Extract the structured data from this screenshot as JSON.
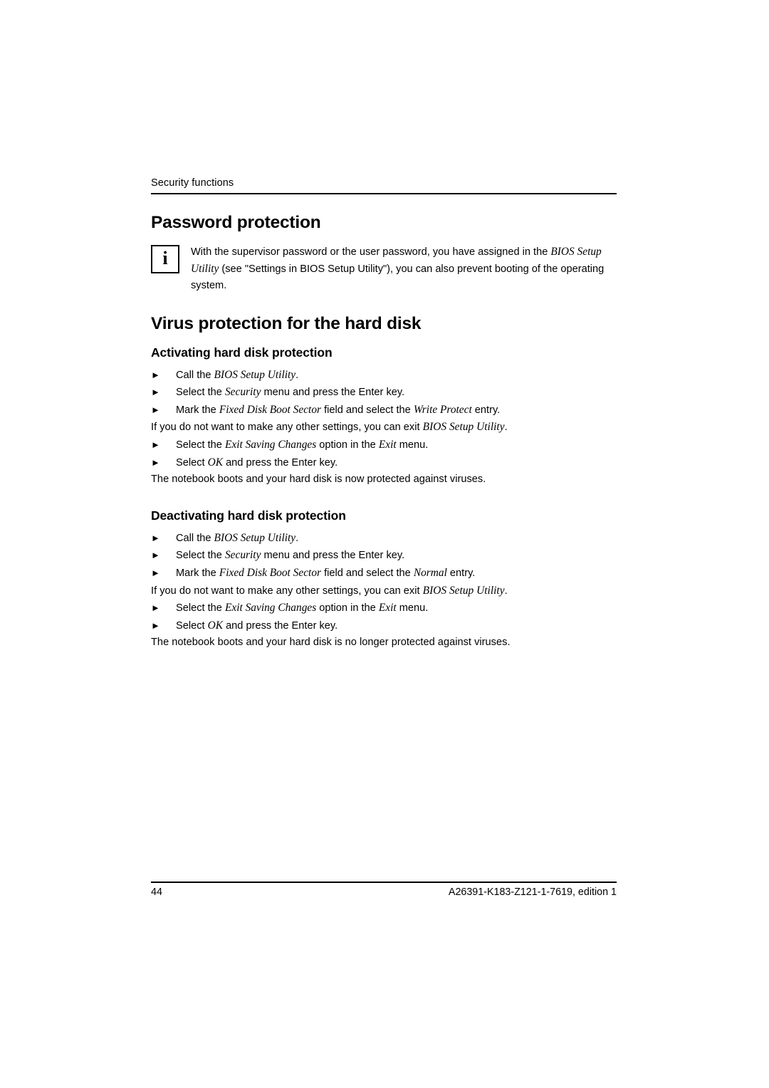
{
  "header": {
    "running_title": "Security functions"
  },
  "sections": {
    "password": {
      "heading": "Password protection",
      "note": {
        "icon": "info-icon",
        "icon_glyph": "i",
        "text_part1": "With the supervisor password or the user password, you have assigned in the ",
        "text_italic1": "BIOS Setup Utility",
        "text_part2": " (see \"Settings in BIOS Setup Utility\"), you can also prevent booting of the operating system."
      }
    },
    "virus": {
      "heading": "Virus protection for the hard disk",
      "activating": {
        "heading": "Activating hard disk protection",
        "steps": [
          {
            "bullet": "►",
            "pre": "Call the ",
            "italic": "BIOS Setup Utility",
            "post": "."
          },
          {
            "bullet": "►",
            "pre": "Select the ",
            "italic": "Security",
            "post": " menu and press the Enter key."
          },
          {
            "bullet": "►",
            "pre": "Mark the ",
            "italic": "Fixed Disk Boot Sector",
            "mid": " field and select the ",
            "italic2": "Write Protect",
            "post": " entry."
          }
        ],
        "note_pre": "If you do not want to make any other settings, you can exit ",
        "note_italic": "BIOS Setup Utility",
        "note_post": ".",
        "steps2": [
          {
            "bullet": "►",
            "pre": "Select the ",
            "italic": "Exit Saving Changes",
            "mid": " option in the ",
            "italic2": "Exit",
            "post": " menu."
          },
          {
            "bullet": "►",
            "pre": "Select ",
            "italic": "OK",
            "post": " and press the Enter key."
          }
        ],
        "result": "The notebook boots and your hard disk is now protected against viruses."
      },
      "deactivating": {
        "heading": "Deactivating hard disk protection",
        "steps": [
          {
            "bullet": "►",
            "pre": "Call the ",
            "italic": "BIOS Setup Utility",
            "post": "."
          },
          {
            "bullet": "►",
            "pre": "Select the ",
            "italic": "Security",
            "post": " menu and press the Enter key."
          },
          {
            "bullet": "►",
            "pre": "Mark the ",
            "italic": "Fixed Disk Boot Sector",
            "mid": " field and select the ",
            "italic2": "Normal",
            "post": " entry."
          }
        ],
        "note_pre": "If you do not want to make any other settings, you can exit ",
        "note_italic": "BIOS Setup Utility",
        "note_post": ".",
        "steps2": [
          {
            "bullet": "►",
            "pre": "Select the ",
            "italic": "Exit Saving Changes",
            "mid": " option in the ",
            "italic2": "Exit",
            "post": " menu."
          },
          {
            "bullet": "►",
            "pre": "Select ",
            "italic": "OK",
            "post": " and press the Enter key."
          }
        ],
        "result": "The notebook boots and your hard disk is no longer protected against viruses."
      }
    }
  },
  "footer": {
    "page_number": "44",
    "document_code": "A26391-K183-Z121-1-7619, edition 1"
  }
}
